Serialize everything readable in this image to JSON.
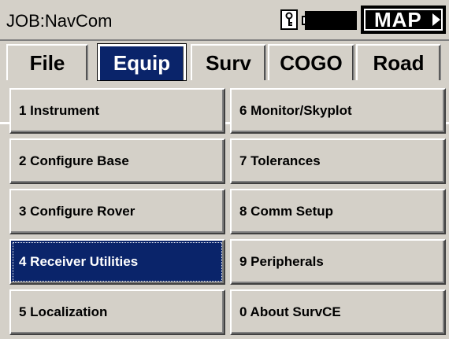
{
  "header": {
    "job_title": "JOB:NavCom",
    "map_label": "MAP"
  },
  "tabs": [
    {
      "label": "File",
      "active": false
    },
    {
      "label": "Equip",
      "active": true
    },
    {
      "label": "Surv",
      "active": false
    },
    {
      "label": "COGO",
      "active": false
    },
    {
      "label": "Road",
      "active": false
    }
  ],
  "menu": {
    "left": [
      {
        "label": "1 Instrument",
        "selected": false
      },
      {
        "label": "2 Configure Base",
        "selected": false
      },
      {
        "label": "3 Configure Rover",
        "selected": false
      },
      {
        "label": "4 Receiver Utilities",
        "selected": true
      },
      {
        "label": "5 Localization",
        "selected": false
      }
    ],
    "right": [
      {
        "label": "6 Monitor/Skyplot",
        "selected": false
      },
      {
        "label": "7 Tolerances",
        "selected": false
      },
      {
        "label": "8 Comm Setup",
        "selected": false
      },
      {
        "label": "9 Peripherals",
        "selected": false
      },
      {
        "label": "0 About SurvCE",
        "selected": false
      }
    ]
  },
  "icons": {
    "key": "key-icon",
    "battery": "battery-icon",
    "map_arrow": "right-arrow-icon"
  },
  "colors": {
    "selected_bg": "#0a246a",
    "face": "#d4d0c8"
  }
}
